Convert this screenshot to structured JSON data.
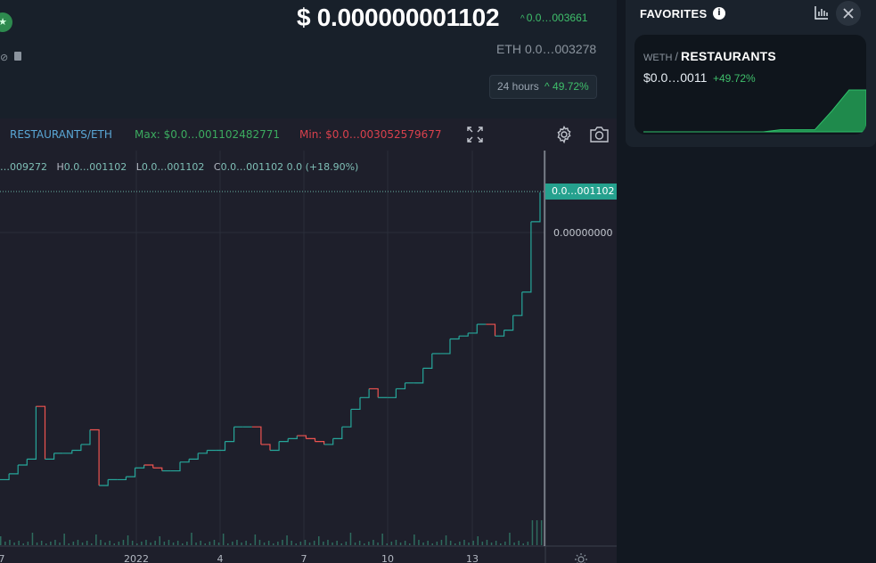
{
  "header": {
    "price_usd": "$ 0.000000001102",
    "price_change": "0.0…003661",
    "eth_label": "ETH",
    "eth_value": "0.0…003278",
    "period": "24 hours",
    "period_change": "49.72%"
  },
  "chart": {
    "pair": "RESTAURANTS/ETH",
    "max_label": "Max: $0.0…001102482771",
    "min_label": "Min: $0.0…003052579677",
    "ohlc": {
      "o": "…009272",
      "h_key": "H",
      "h": "0.0…001102",
      "l_key": "L",
      "l": "0.0…001102",
      "c_key": "C",
      "c": "0.0…001102 0.0 (+18.90%)"
    },
    "last_price_tag": "0.0…001102",
    "scale_label": "0.00000000",
    "x_ticks": [
      {
        "label": "7",
        "pos": "left-edge"
      },
      {
        "label": "2022"
      },
      {
        "label": "4"
      },
      {
        "label": "7"
      },
      {
        "label": "10"
      },
      {
        "label": "13"
      }
    ],
    "colors": {
      "up": "#26a69a",
      "down": "#ef5350",
      "background": "#1e1f2b",
      "grid": "#2a2e39"
    }
  },
  "chart_data": {
    "type": "line",
    "title": "",
    "xlabel": "",
    "ylabel": "",
    "note_units": "relative price level, 0 = chart min, 1 = chart max",
    "x": [
      0,
      1,
      2,
      3,
      4,
      5,
      6,
      7,
      8,
      9,
      10,
      11,
      12,
      13,
      14,
      15,
      16,
      17,
      18,
      19,
      20,
      21,
      22,
      23,
      24,
      25,
      26,
      27,
      28,
      29,
      30,
      31,
      32,
      33,
      34,
      35,
      36,
      37,
      38,
      39,
      40,
      41,
      42,
      43,
      44,
      45,
      46,
      47,
      48,
      49,
      50,
      51,
      52,
      53,
      54,
      55,
      56,
      57,
      58,
      59,
      60
    ],
    "series": [
      {
        "values": [
          0.02,
          0.04,
          0.07,
          0.09,
          0.27,
          0.09,
          0.11,
          0.11,
          0.12,
          0.14,
          0.19,
          0.0,
          0.02,
          0.02,
          0.03,
          0.06,
          0.07,
          0.06,
          0.05,
          0.05,
          0.08,
          0.09,
          0.11,
          0.12,
          0.12,
          0.15,
          0.2,
          0.2,
          0.2,
          0.14,
          0.12,
          0.15,
          0.16,
          0.17,
          0.16,
          0.15,
          0.14,
          0.16,
          0.2,
          0.26,
          0.3,
          0.33,
          0.3,
          0.3,
          0.33,
          0.35,
          0.35,
          0.4,
          0.45,
          0.45,
          0.5,
          0.51,
          0.52,
          0.55,
          0.55,
          0.51,
          0.53,
          0.58,
          0.66,
          0.9,
          1.0
        ]
      }
    ]
  },
  "favorites": {
    "title": "FAVORITES",
    "card": {
      "base": "WETH",
      "sep": "/",
      "quote": "RESTAURANTS",
      "price": "$0.0…0011",
      "change": "+49.72%"
    },
    "spark": {
      "values": [
        0,
        0,
        0,
        0,
        0,
        0,
        0,
        0,
        0.05,
        0.05,
        0.05,
        0.5,
        1.0,
        1.0
      ],
      "color": "#1f8a4c"
    }
  }
}
